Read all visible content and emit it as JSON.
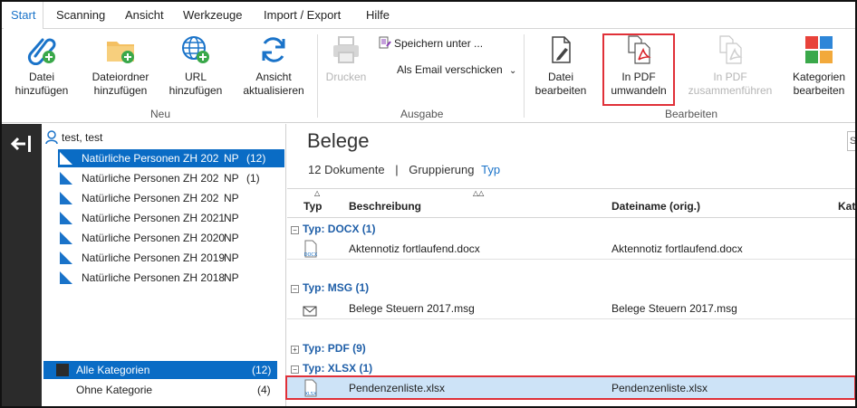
{
  "tabs": [
    "Start",
    "Scanning",
    "Ansicht",
    "Werkzeuge",
    "Import / Export",
    "Hilfe"
  ],
  "ribbon": {
    "neu": {
      "label": "Neu",
      "datei": [
        "Datei",
        "hinzufügen"
      ],
      "ordner": [
        "Dateiordner",
        "hinzufügen"
      ],
      "url": [
        "URL",
        "hinzufügen"
      ],
      "refresh": [
        "Ansicht",
        "aktualisieren"
      ]
    },
    "ausgabe": {
      "label": "Ausgabe",
      "drucken": "Drucken",
      "speichern": "Speichern unter ...",
      "email": "Als Email verschicken"
    },
    "bearbeiten": {
      "label": "Bearbeiten",
      "datei_bearbeiten": [
        "Datei",
        "bearbeiten"
      ],
      "pdf_umwandeln": [
        "In PDF",
        "umwandeln"
      ],
      "pdf_zusammen": [
        "In PDF",
        "zusammenführen"
      ],
      "kategorien": [
        "Kategorien",
        "bearbeiten"
      ]
    }
  },
  "sidebar": {
    "user": "test, test",
    "folders": [
      {
        "label": "Natürliche Personen ZH 202",
        "suffix": "NP",
        "count": "(12)"
      },
      {
        "label": "Natürliche Personen ZH 202",
        "suffix": "NP",
        "count": "(1)"
      },
      {
        "label": "Natürliche Personen ZH 202",
        "suffix": "NP",
        "count": ""
      },
      {
        "label": "Natürliche Personen ZH 2021",
        "suffix": "NP",
        "count": ""
      },
      {
        "label": "Natürliche Personen ZH 2020",
        "suffix": "NP",
        "count": ""
      },
      {
        "label": "Natürliche Personen ZH 2019",
        "suffix": "NP",
        "count": ""
      },
      {
        "label": "Natürliche Personen ZH 2018",
        "suffix": "NP",
        "count": ""
      }
    ],
    "categories": [
      {
        "label": "Alle Kategorien",
        "count": "(12)"
      },
      {
        "label": "Ohne Kategorie",
        "count": "(4)"
      }
    ]
  },
  "main": {
    "title": "Belege",
    "doc_count": "12 Dokumente",
    "separator": "|",
    "grouping_label": "Gruppierung",
    "grouping_value": "Typ",
    "columns": [
      "Typ",
      "Beschreibung",
      "Dateiname (orig.)",
      "Kate"
    ],
    "groups": [
      {
        "label": "Typ: DOCX (1)",
        "expanded": true,
        "rows": [
          {
            "icon": "DOCX",
            "desc": "Aktennotiz fortlaufend.docx",
            "file": "Aktennotiz fortlaufend.docx"
          }
        ]
      },
      {
        "label": "Typ: MSG (1)",
        "expanded": true,
        "rows": [
          {
            "icon": "mail",
            "desc": "Belege Steuern 2017.msg",
            "file": "Belege Steuern 2017.msg"
          }
        ]
      },
      {
        "label": "Typ: PDF (9)",
        "expanded": false,
        "rows": []
      },
      {
        "label": "Typ: XLSX (1)",
        "expanded": true,
        "rows": [
          {
            "icon": "XLSX",
            "desc": "Pendenzenliste.xlsx",
            "file": "Pendenzenliste.xlsx"
          }
        ]
      }
    ]
  },
  "colors": {
    "accent": "#0a6cc5",
    "highlight": "#e03038",
    "group_text": "#1f5fa8",
    "nav_bg": "#2b2b2b"
  }
}
